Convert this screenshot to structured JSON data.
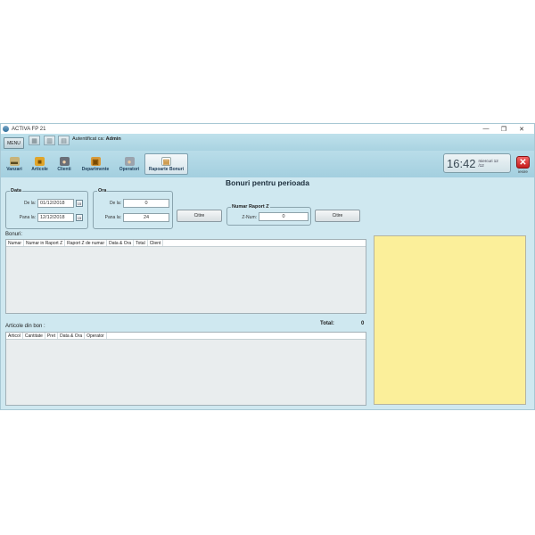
{
  "window": {
    "title": "ACTIVA FP 21"
  },
  "titlebar_controls": {
    "minimize": "—",
    "maximize": "❐",
    "close": "✕"
  },
  "topbar": {
    "menu_label": "MENU",
    "auth_prefix": "Autentificat ca:",
    "auth_user": "Admin"
  },
  "nav": [
    {
      "label": "Vanzari",
      "icon": "cart-icon"
    },
    {
      "label": "Articole",
      "icon": "box-icon"
    },
    {
      "label": "Clienti",
      "icon": "person-icon"
    },
    {
      "label": "Departmente",
      "icon": "department-icon"
    },
    {
      "label": "Operatori",
      "icon": "operators-icon"
    },
    {
      "label": "Rapoarte Bonuri",
      "icon": "report-icon"
    }
  ],
  "clock": {
    "time": "16:42",
    "day": "miercuri 12",
    "month": "/12"
  },
  "exit_label": "iesire",
  "heading": "Bonuri pentru perioada",
  "data_group": {
    "legend": "Data",
    "from_label": "De la:",
    "from_value": "01/12/2018",
    "to_label": "Pana la:",
    "to_value": "12/12/2018",
    "calendar_day": "15"
  },
  "ora_group": {
    "legend": "Ora",
    "from_label": "De la:",
    "from_value": "0",
    "to_label": "Pana la:",
    "to_value": "24"
  },
  "read_button_1": "Citire",
  "raport_group": {
    "legend": "Numar Raport Z",
    "label": "Z-Num:",
    "value": "0"
  },
  "read_button_2": "Citire",
  "bonuri": {
    "label": "Bonuri:",
    "columns": [
      "Numar",
      "Numar in Raport Z",
      "Raport Z de numar",
      "Data & Ora",
      "Total",
      "Client"
    ]
  },
  "total": {
    "label": "Total:",
    "value": "0"
  },
  "articole": {
    "label": "Articole din bon :",
    "columns": [
      "Articol",
      "Cantitate",
      "Pret",
      "Data & Ora",
      "Operator"
    ]
  }
}
